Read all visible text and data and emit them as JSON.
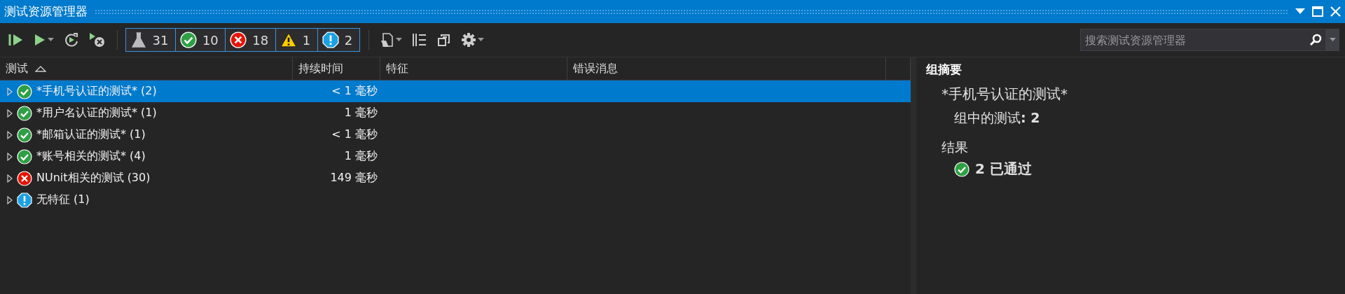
{
  "window": {
    "title": "测试资源管理器"
  },
  "filters": [
    {
      "kind": "total",
      "count": "31"
    },
    {
      "kind": "passed",
      "count": "10"
    },
    {
      "kind": "failed",
      "count": "18"
    },
    {
      "kind": "warning",
      "count": "1"
    },
    {
      "kind": "notrun",
      "count": "2"
    }
  ],
  "search": {
    "placeholder": "搜索测试资源管理器"
  },
  "table": {
    "columns": [
      {
        "label": "测试",
        "sorted": true
      },
      {
        "label": "持续时间",
        "sorted": false
      },
      {
        "label": "特征",
        "sorted": false
      },
      {
        "label": "错误消息",
        "sorted": false
      }
    ],
    "rows": [
      {
        "kind": "passed",
        "name": "*手机号认证的测试* (2)",
        "duration": "< 1 毫秒",
        "selected": true,
        "expanded": false
      },
      {
        "kind": "passed",
        "name": "*用户名认证的测试* (1)",
        "duration": "1 毫秒",
        "selected": false,
        "expanded": false
      },
      {
        "kind": "passed",
        "name": "*邮箱认证的测试* (1)",
        "duration": "< 1 毫秒",
        "selected": false,
        "expanded": false
      },
      {
        "kind": "passed",
        "name": "*账号相关的测试* (4)",
        "duration": "1 毫秒",
        "selected": false,
        "expanded": false
      },
      {
        "kind": "failed",
        "name": "NUnit相关的测试 (30)",
        "duration": "149 毫秒",
        "selected": false,
        "expanded": false
      },
      {
        "kind": "notrun",
        "name": "无特征 (1)",
        "selected": false,
        "expanded": false
      }
    ]
  },
  "summary": {
    "heading": "组摘要",
    "group_name": "*手机号认证的测试*",
    "group_count": "组中的测试**: 2**",
    "results_label": "结果",
    "results": [
      {
        "kind": "passed",
        "text": "2 已通过"
      }
    ]
  }
}
